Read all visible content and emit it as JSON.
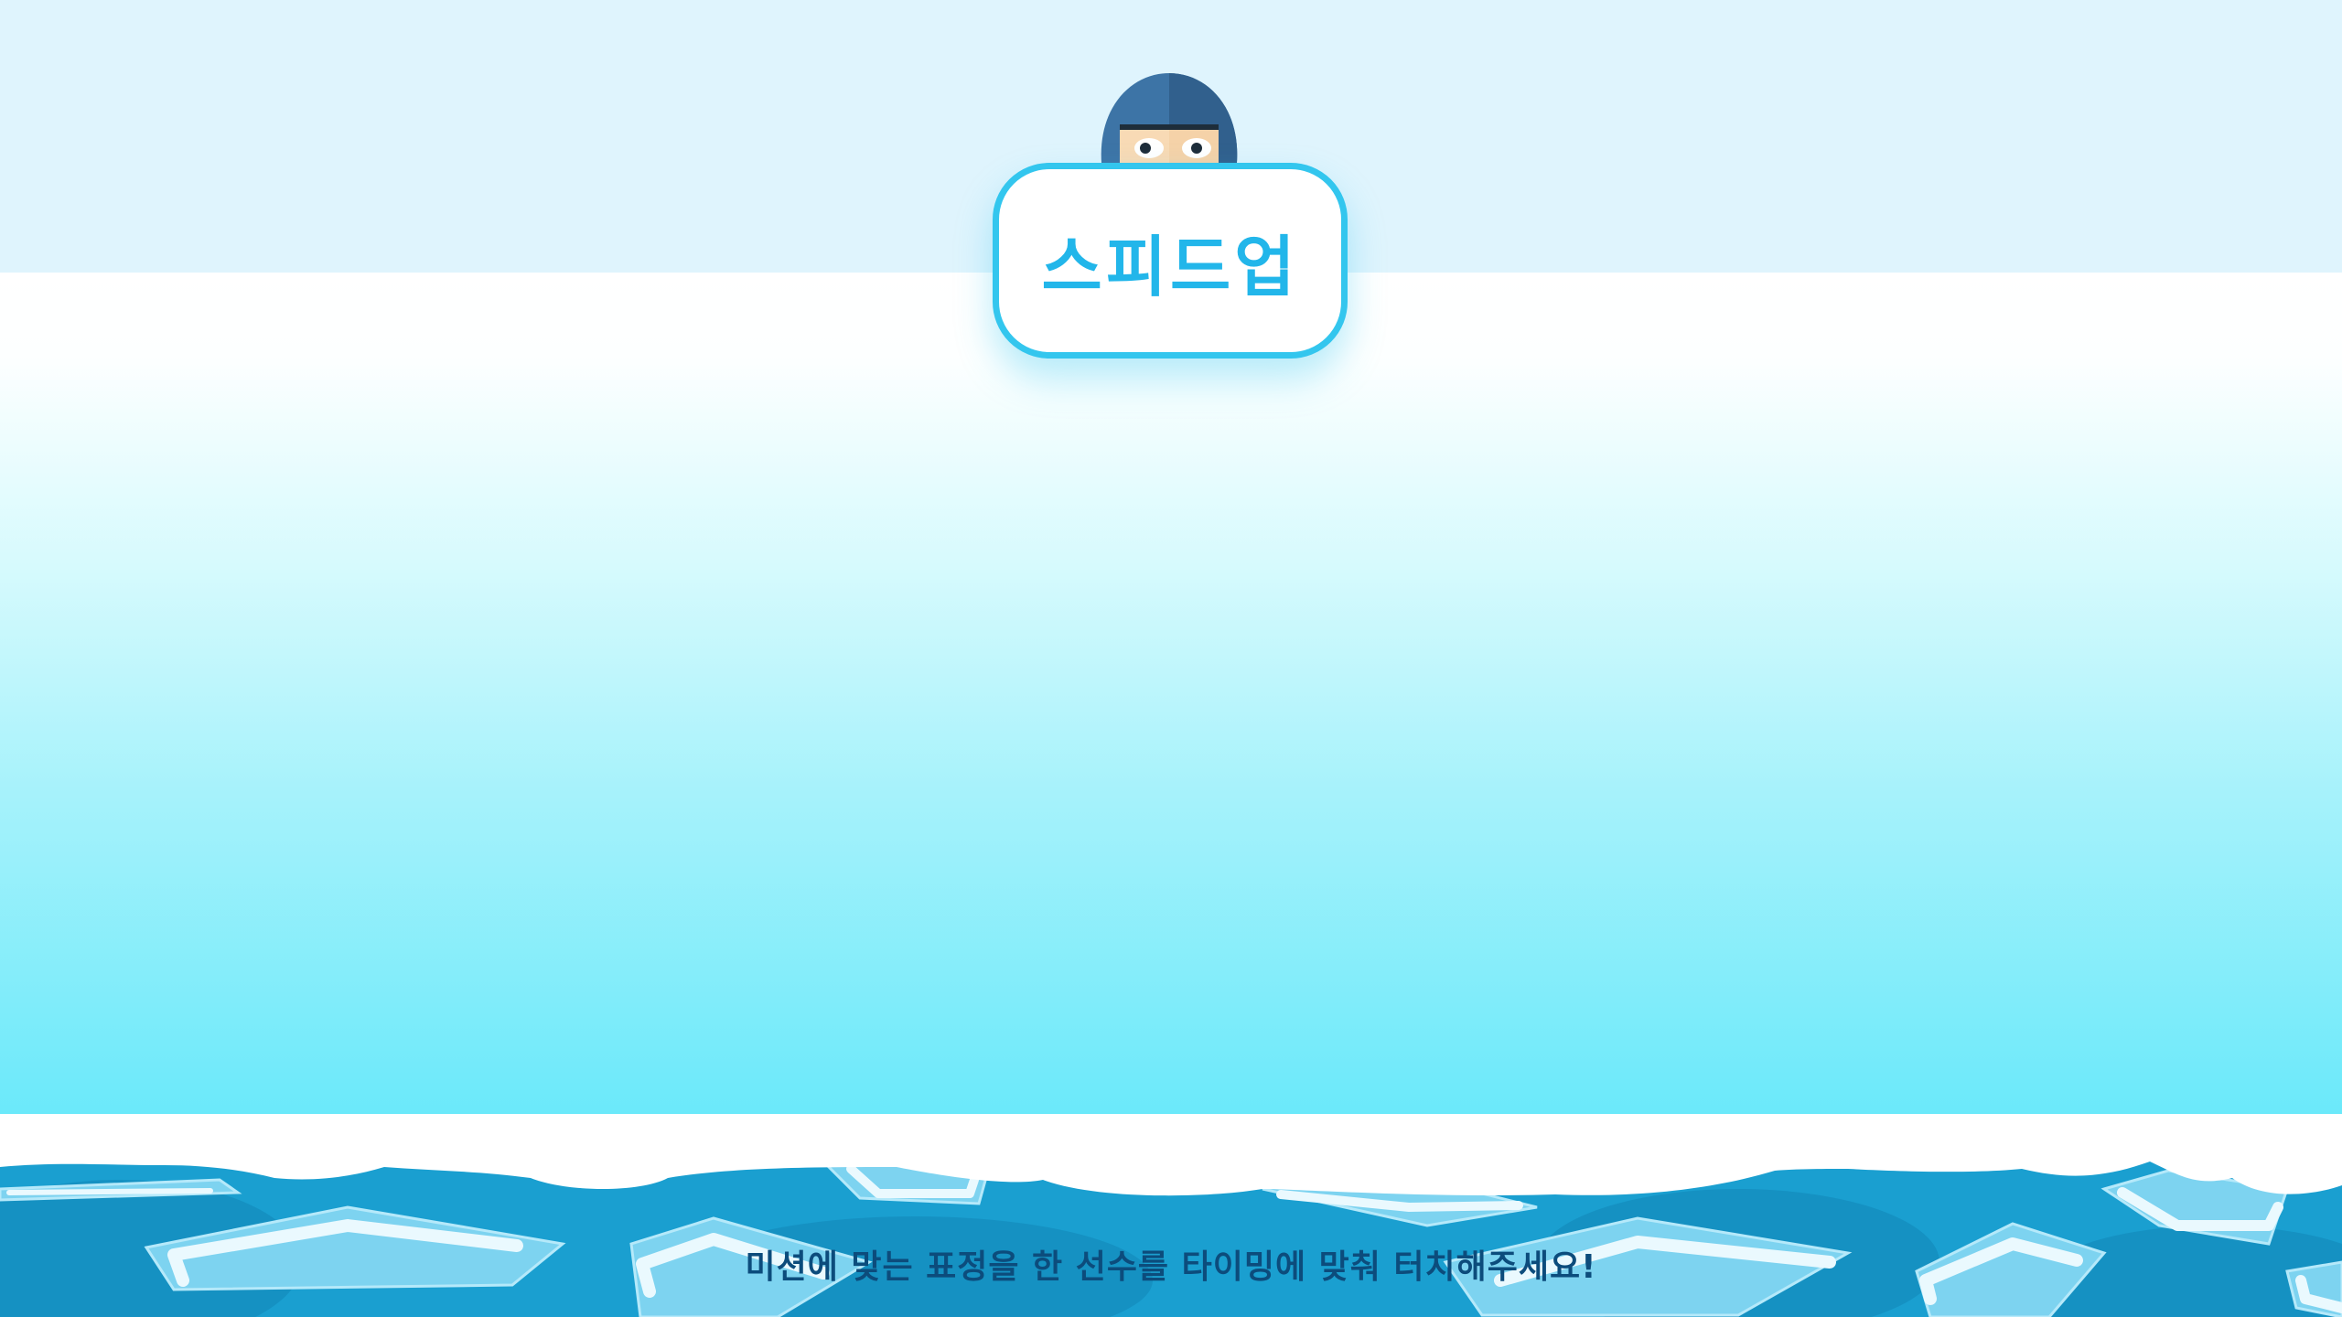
{
  "game": {
    "title": "스피드업",
    "instruction": "미션에 맞는 표정을 한 선수를 타이밍에 맞춰 터치해주세요!"
  },
  "icons": {
    "mascot": "helmeted-athlete-peeking-icon"
  },
  "colors": {
    "top_band": "#dff4fd",
    "card_border": "#33c6ee",
    "title_text": "#22b6ea",
    "instruction_text": "#0c4c7c",
    "water": "#1a9fd0",
    "ice": "#7dd3f0"
  }
}
